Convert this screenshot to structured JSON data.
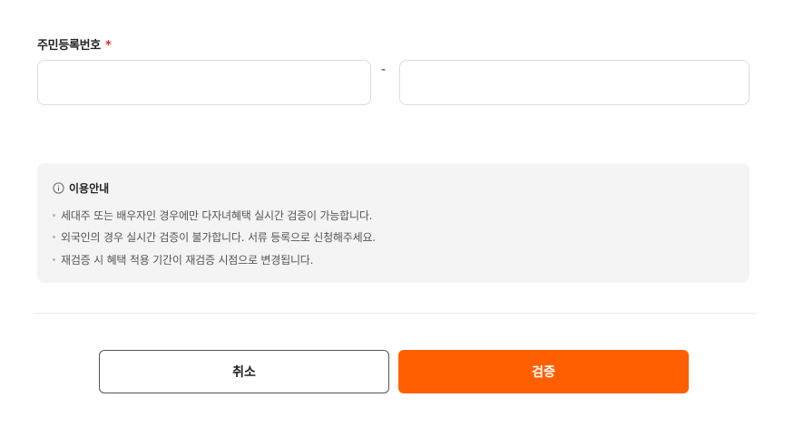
{
  "form": {
    "rrn_label": "주민등록번호",
    "required_mark": "*",
    "separator": "-",
    "rrn_front_value": "",
    "rrn_back_value": ""
  },
  "notice": {
    "icon": "info-circle-icon",
    "title": "이용안내",
    "items": [
      "세대주 또는 배우자인 경우에만 다자녀혜택 실시간 검증이 가능합니다.",
      "외국인의 경우 실시간 검증이 불가합니다. 서류 등록으로 신청해주세요.",
      "재검증 시 혜택 적용 기간이 재검증 시점으로 변경됩니다."
    ]
  },
  "actions": {
    "cancel_label": "취소",
    "verify_label": "검증"
  },
  "colors": {
    "accent": "#ff5f00",
    "required": "#e02d20",
    "notice_bg": "#f4f4f4"
  }
}
